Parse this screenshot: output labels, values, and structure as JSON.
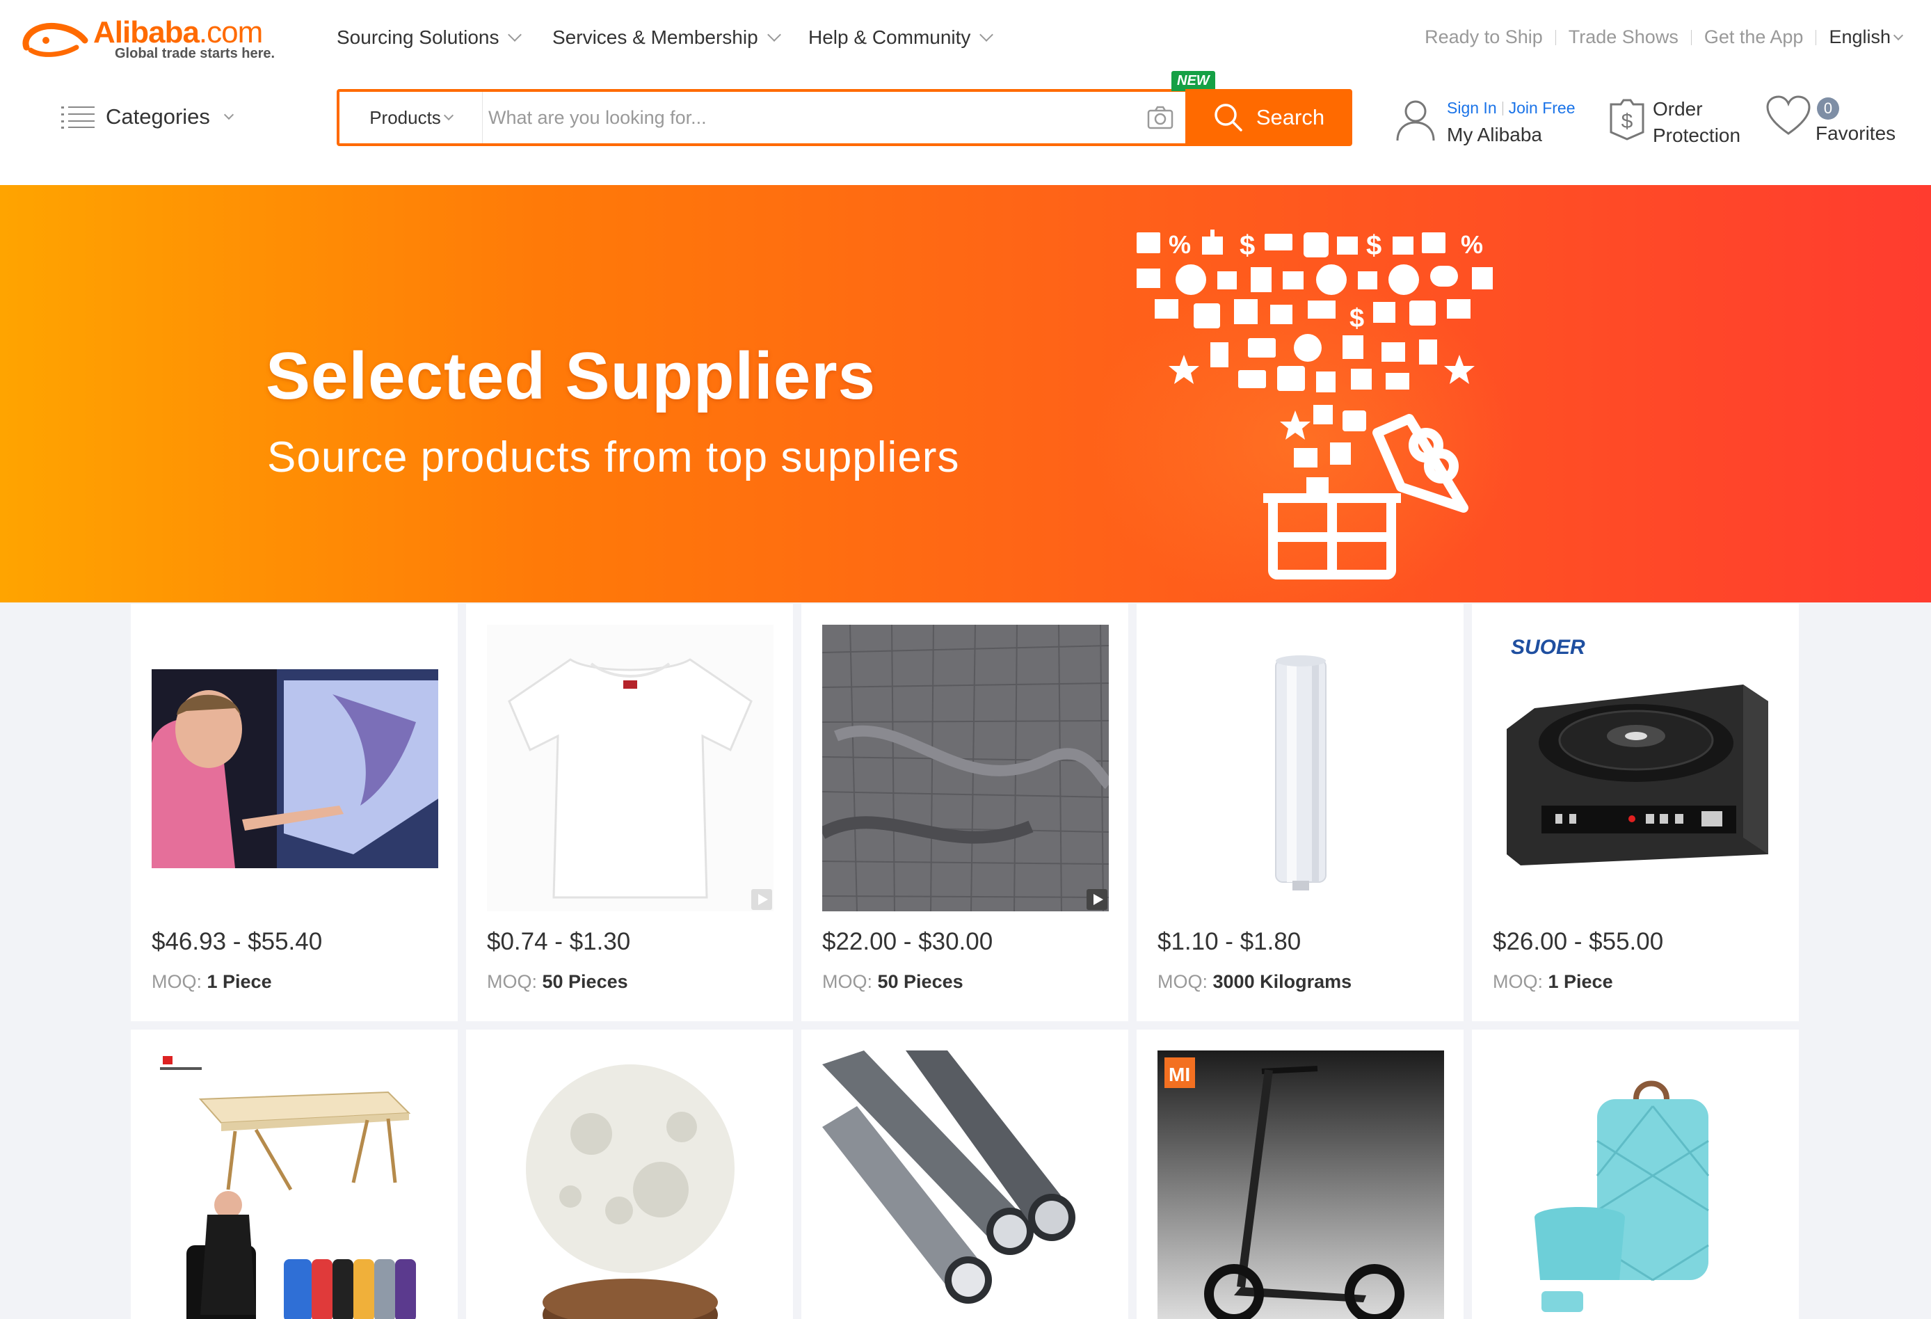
{
  "header": {
    "logo_word": "Alibaba",
    "logo_dotcom": ".com",
    "logo_tagline": "Global trade starts here.",
    "nav": [
      {
        "label": "Sourcing Solutions"
      },
      {
        "label": "Services & Membership"
      },
      {
        "label": "Help & Community"
      }
    ],
    "top_links": {
      "ready_to_ship": "Ready to Ship",
      "trade_shows": "Trade Shows",
      "get_app": "Get the App",
      "language": "English"
    },
    "categories_label": "Categories",
    "search": {
      "category": "Products",
      "placeholder": "What are you looking for...",
      "button_label": "Search",
      "new_badge": "NEW"
    },
    "account": {
      "sign_in": "Sign In",
      "join_free": "Join Free",
      "title": "My Alibaba"
    },
    "order_protection": {
      "line1": "Order",
      "line2": "Protection"
    },
    "favorites": {
      "count": "0",
      "label": "Favorites"
    }
  },
  "banner": {
    "title": "Selected Suppliers",
    "subtitle": "Source products from top suppliers"
  },
  "products": [
    {
      "price": "$46.93 - $55.40",
      "moq_label": "MOQ:",
      "moq_value": "1 Piece",
      "icon": "touch-screen-display"
    },
    {
      "price": "$0.74 - $1.30",
      "moq_label": "MOQ:",
      "moq_value": "50 Pieces",
      "icon": "white-tshirt"
    },
    {
      "price": "$22.00 - $30.00",
      "moq_label": "MOQ:",
      "moq_value": "50 Pieces",
      "icon": "weighted-blanket"
    },
    {
      "price": "$1.10 - $1.80",
      "moq_label": "MOQ:",
      "moq_value": "3000 Kilograms",
      "icon": "stretch-film-roll"
    },
    {
      "price": "$26.00 - $55.00",
      "moq_label": "MOQ:",
      "moq_value": "1 Piece",
      "icon": "car-subwoofer",
      "brand": "SUOER"
    },
    {
      "icon": "massage-table"
    },
    {
      "icon": "moon-lamp"
    },
    {
      "icon": "steel-pipes"
    },
    {
      "icon": "electric-scooter",
      "brand": "MI"
    },
    {
      "icon": "diaper-backpack"
    }
  ],
  "colors": {
    "brand_orange": "#ff6a00",
    "new_green": "#15a045",
    "link_blue": "#1a73e8"
  }
}
